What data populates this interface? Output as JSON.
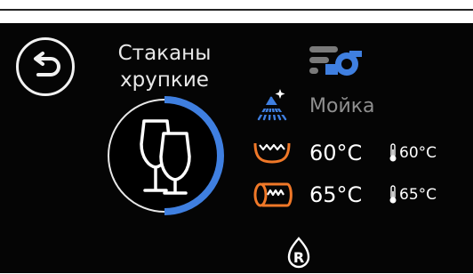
{
  "program": {
    "title_line1": "Стаканы",
    "title_line2": "хрупкие",
    "progress_fraction": 0.5
  },
  "stage": {
    "label": "Мойка"
  },
  "wash": {
    "set_temp": "60°C",
    "actual_temp": "60°C"
  },
  "rinse": {
    "set_temp": "65°C",
    "actual_temp": "65°C"
  },
  "icons": {
    "back": "back-arrow-icon",
    "glass": "wine-glasses-icon",
    "feature": "wash-pump-icon",
    "stage": "spray-shower-icon",
    "wash_tank": "tank-heater-icon",
    "boiler": "boiler-heater-icon",
    "thermometer": "thermometer-icon",
    "rinse_aid": "rinse-aid-r-icon"
  },
  "colors": {
    "background": "#050505",
    "accent_blue": "#3f7fe0",
    "heater_orange": "#f07828",
    "text": "#ffffff",
    "muted_text": "#8f8f8f"
  }
}
